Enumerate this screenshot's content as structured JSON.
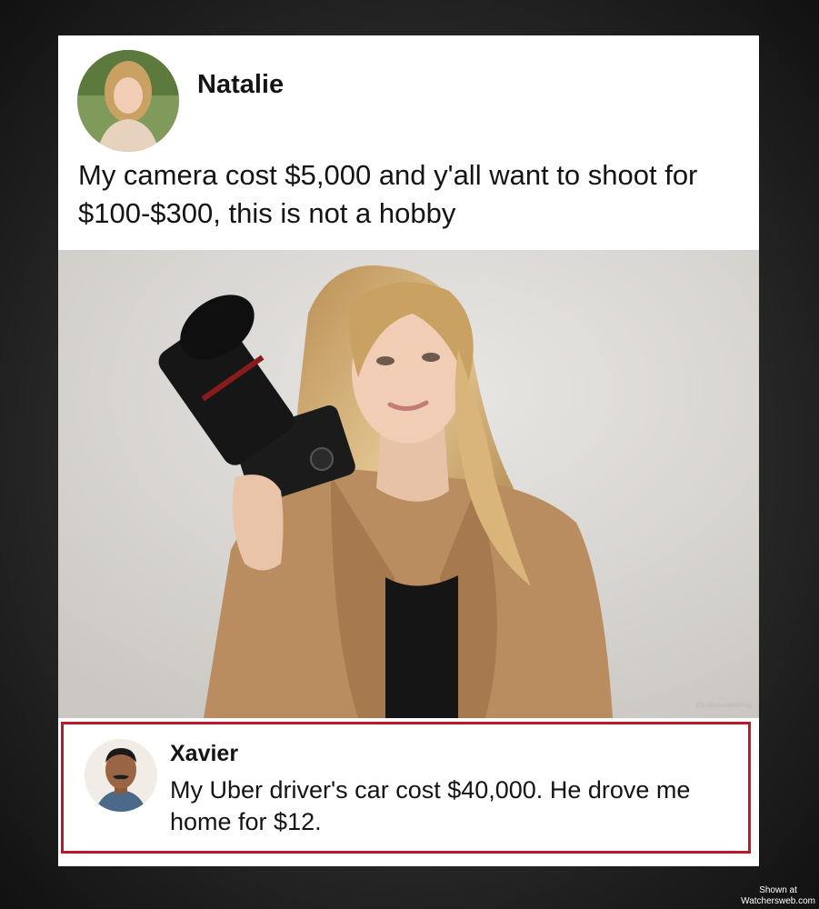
{
  "post": {
    "author": "Natalie",
    "text": "My camera cost $5,000 and y'all want to shoot for $100-$300, this is not a hobby",
    "image_watermark": "@pakaluxavierog"
  },
  "reply": {
    "author": "Xavier",
    "text": "My Uber driver's car cost $40,000. He drove me home for $12."
  },
  "credit": {
    "line1": "Shown at",
    "line2": "Watchersweb.com"
  },
  "colors": {
    "highlight_border": "#c0162a",
    "card_background": "#ffffff",
    "text": "#141414"
  }
}
